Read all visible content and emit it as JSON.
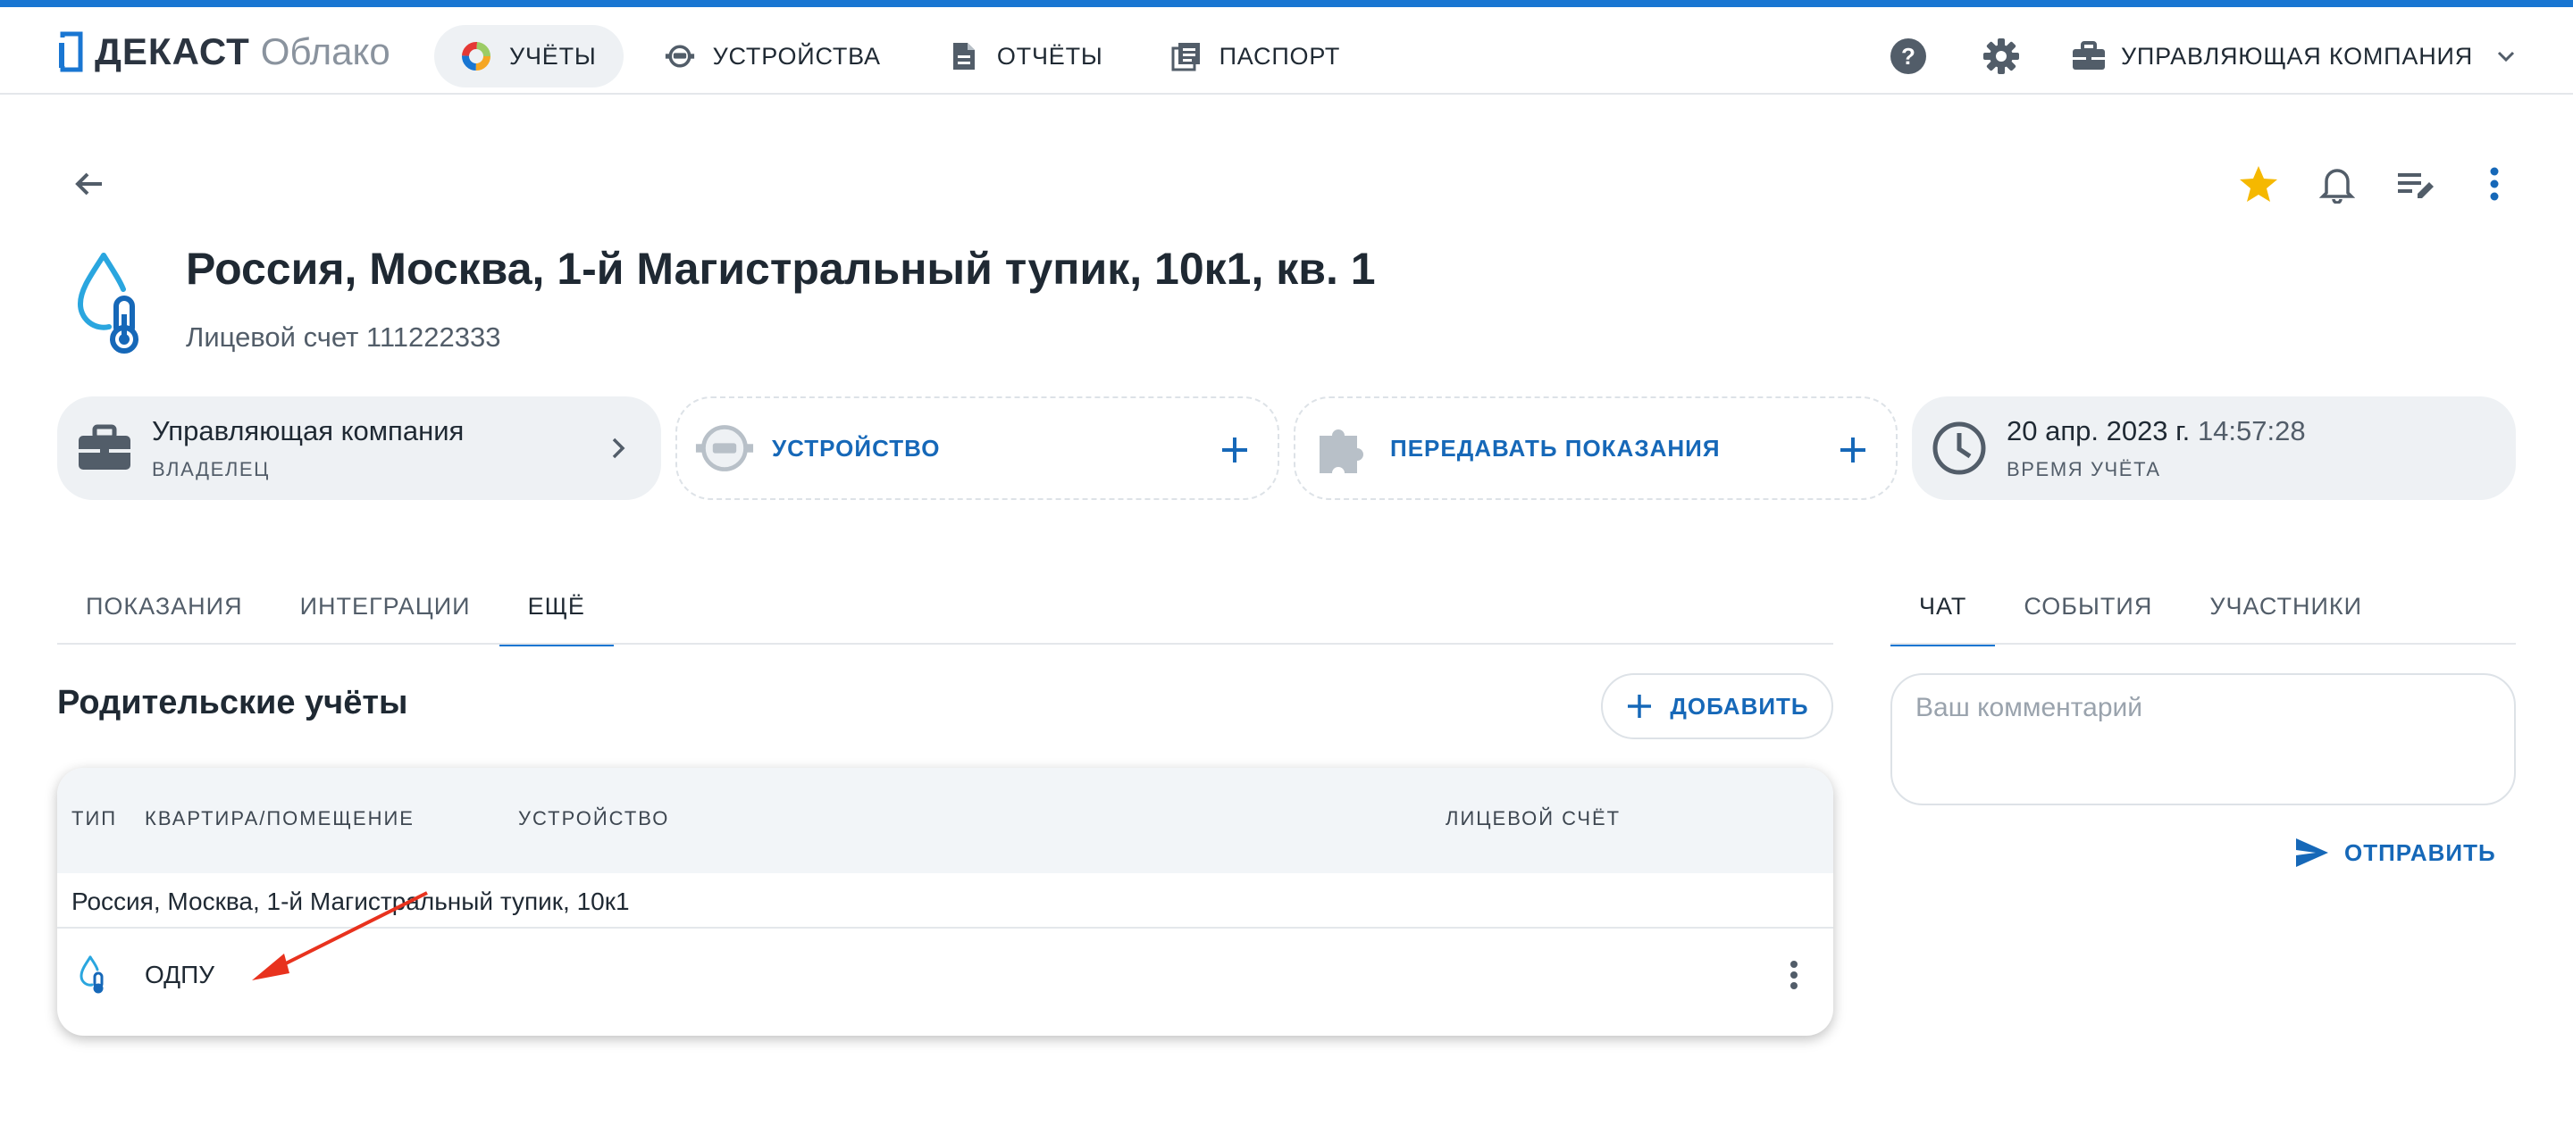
{
  "app": {
    "brand": "ДЕКАСТ",
    "product": "Облако"
  },
  "nav": {
    "items": [
      {
        "label": "УЧЁТЫ",
        "icon": "accounts-colorful-icon",
        "active": true
      },
      {
        "label": "УСТРОЙСТВА",
        "icon": "device-icon",
        "active": false
      },
      {
        "label": "ОТЧЁТЫ",
        "icon": "document-icon",
        "active": false
      },
      {
        "label": "ПАСПОРТ",
        "icon": "passport-icon",
        "active": false
      }
    ],
    "company_label": "УПРАВЛЯЮЩАЯ КОМПАНИЯ"
  },
  "header": {
    "title": "Россия, Москва, 1-й Магистральный тупик, 10к1, кв. 1",
    "subtitle": "Лицевой счет 111222333"
  },
  "cards": {
    "owner": {
      "main": "Управляющая компания",
      "sub": "ВЛАДЕЛЕЦ"
    },
    "device": {
      "label": "УСТРОЙСТВО"
    },
    "readings": {
      "label": "ПЕРЕДАВАТЬ ПОКАЗАНИЯ"
    },
    "time": {
      "date": "20 апр. 2023 г.",
      "clock": "14:57:28",
      "sub": "ВРЕМЯ УЧЁТА"
    }
  },
  "tabs": [
    {
      "label": "ПОКАЗАНИЯ",
      "active": false
    },
    {
      "label": "ИНТЕГРАЦИИ",
      "active": false
    },
    {
      "label": "ЕЩЁ",
      "active": true
    }
  ],
  "side_tabs": [
    {
      "label": "ЧАТ",
      "active": true
    },
    {
      "label": "СОБЫТИЯ",
      "active": false
    },
    {
      "label": "УЧАСТНИКИ",
      "active": false
    }
  ],
  "section": {
    "title": "Родительские учёты",
    "add_label": "ДОБАВИТЬ"
  },
  "table": {
    "columns": [
      "ТИП",
      "КВАРТИРА/ПОМЕЩЕНИЕ",
      "УСТРОЙСТВО",
      "ЛИЦЕВОЙ СЧЁТ"
    ],
    "group": "Россия, Москва, 1-й Магистральный тупик, 10к1",
    "rows": [
      {
        "type_icon": "water-thermometer-icon",
        "name": "ОДПУ"
      }
    ]
  },
  "chat": {
    "placeholder": "Ваш комментарий",
    "send_label": "ОТПРАВИТЬ"
  },
  "colors": {
    "accent": "#1976d2",
    "link": "#1668b8",
    "star": "#f5b800",
    "annotation": "#e8321e"
  }
}
